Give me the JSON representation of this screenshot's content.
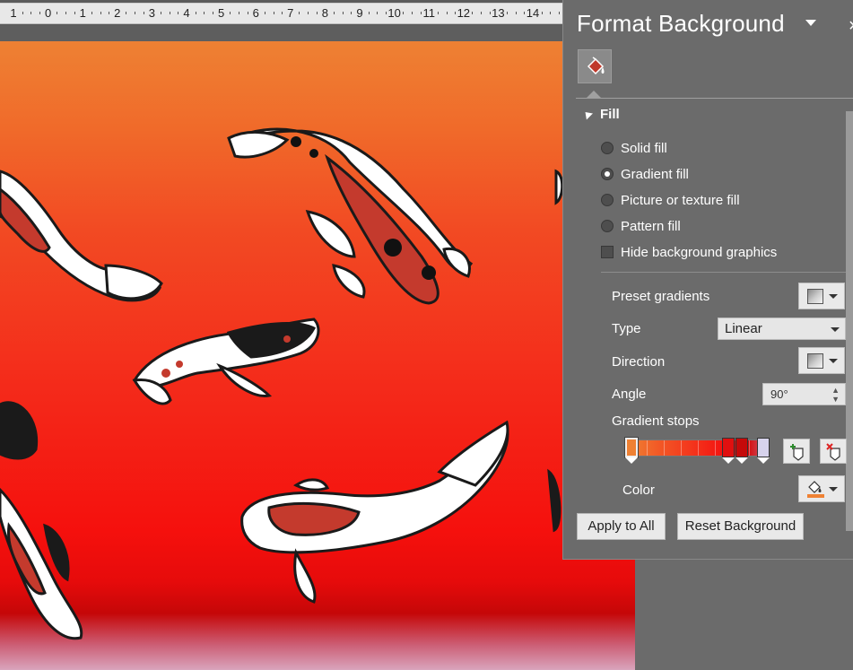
{
  "ruler": {
    "labels": [
      "1",
      "0",
      "1",
      "2",
      "3",
      "4",
      "5",
      "6",
      "7",
      "8",
      "9",
      "10",
      "11",
      "12",
      "13",
      "14"
    ]
  },
  "panel": {
    "title": "Format Background",
    "section_title": "Fill",
    "fill_options": [
      {
        "label": "Solid fill",
        "selected": false
      },
      {
        "label": "Gradient fill",
        "selected": true
      },
      {
        "label": "Picture or texture fill",
        "selected": false
      },
      {
        "label": "Pattern fill",
        "selected": false
      }
    ],
    "hide_background_label": "Hide background graphics",
    "hide_background_checked": false,
    "preset_gradients_label": "Preset gradients",
    "type_label": "Type",
    "type_value": "Linear",
    "direction_label": "Direction",
    "angle_label": "Angle",
    "angle_value": "90°",
    "gradient_stops_label": "Gradient stops",
    "gradient_stops": [
      {
        "color": "#ef8133",
        "selected": true
      },
      {
        "color": "#e01010",
        "selected": false
      },
      {
        "color": "#c50a0a",
        "selected": false
      },
      {
        "color": "#d7d3ec",
        "selected": false
      }
    ],
    "color_label": "Color",
    "color_swatch": "#ef8133",
    "apply_all_label": "Apply to All",
    "reset_label": "Reset Background"
  },
  "colors": {
    "panel_bg": "#6b6b6b",
    "accent_fill_icon": "#c0392b"
  }
}
